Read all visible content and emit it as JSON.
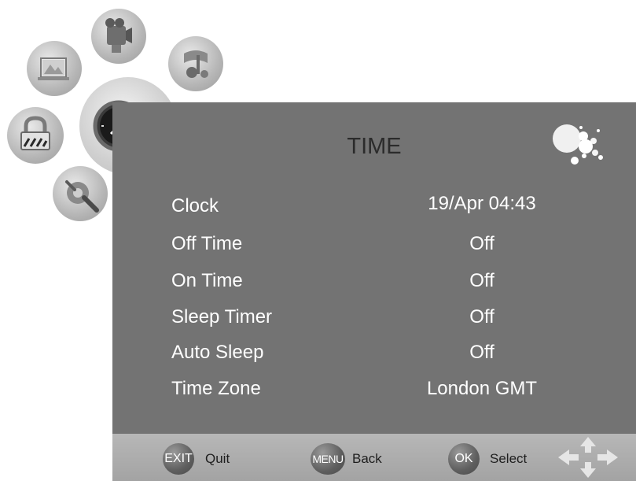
{
  "menu": {
    "title": "TIME",
    "rows": [
      {
        "label": "Clock",
        "value": "19/Apr 04:43"
      },
      {
        "label": "Off Time",
        "value": "Off"
      },
      {
        "label": "On Time",
        "value": "Off"
      },
      {
        "label": "Sleep Timer",
        "value": "Off"
      },
      {
        "label": "Auto Sleep",
        "value": "Off"
      },
      {
        "label": "Time Zone",
        "value": "London GMT"
      }
    ]
  },
  "categories": [
    {
      "icon": "picture-icon"
    },
    {
      "icon": "camera-icon"
    },
    {
      "icon": "sound-icon"
    },
    {
      "icon": "lock-icon"
    },
    {
      "icon": "clock-icon",
      "selected": true
    },
    {
      "icon": "setup-icon"
    }
  ],
  "footer": {
    "quit": {
      "key": "EXIT",
      "label": "Quit"
    },
    "back": {
      "key": "MENU",
      "label": "Back"
    },
    "select": {
      "key": "OK",
      "label": "Select"
    }
  },
  "colors": {
    "panel": "#737373",
    "footer": "#aaaaaa",
    "text": "#ffffff",
    "title": "#2b2b2b"
  }
}
